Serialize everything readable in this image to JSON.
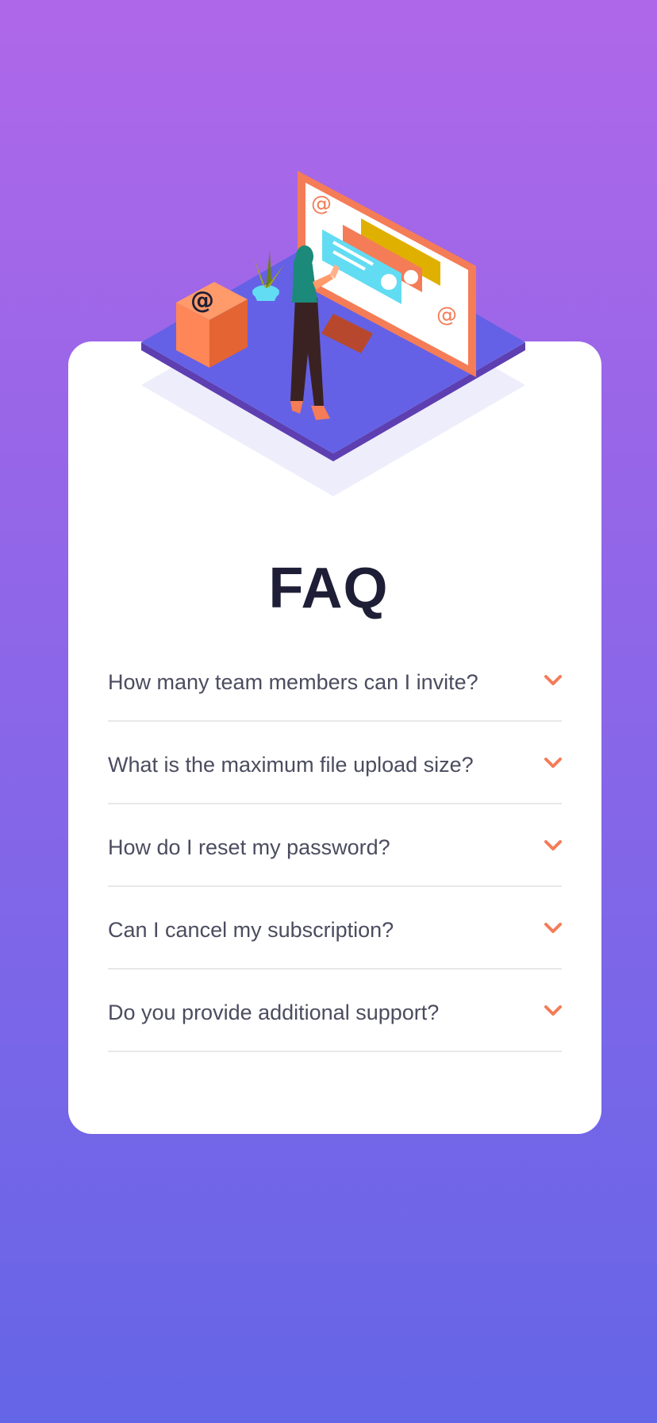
{
  "page": {
    "title": "FAQ"
  },
  "faq": {
    "items": [
      {
        "question": "How many team members can I invite?",
        "icon": "chevron-down-icon"
      },
      {
        "question": "What is the maximum file upload size?",
        "icon": "chevron-down-icon"
      },
      {
        "question": "How do I reset my password?",
        "icon": "chevron-down-icon"
      },
      {
        "question": "Can I cancel my subscription?",
        "icon": "chevron-down-icon"
      },
      {
        "question": "Do you provide additional support?",
        "icon": "chevron-down-icon"
      }
    ]
  },
  "colors": {
    "background_top": "#af67e9",
    "background_bottom": "#6565e7",
    "card": "#ffffff",
    "title": "#1e1f36",
    "question_text": "#4b4c5f",
    "accent": "#f47c57",
    "divider": "#e8e8ea"
  }
}
